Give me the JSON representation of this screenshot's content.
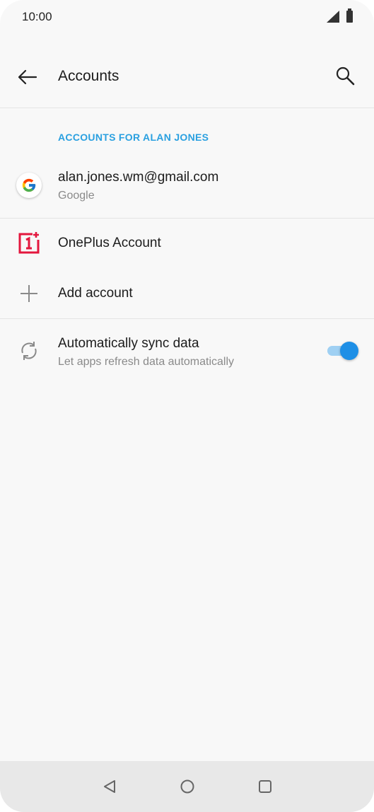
{
  "status_bar": {
    "time": "10:00"
  },
  "app_bar": {
    "title": "Accounts"
  },
  "section": {
    "header": "ACCOUNTS FOR ALAN JONES"
  },
  "accounts": [
    {
      "primary": "alan.jones.wm@gmail.com",
      "secondary": "Google",
      "icon": "google-icon"
    },
    {
      "primary": "OnePlus Account",
      "icon": "oneplus-icon"
    }
  ],
  "add_account": {
    "label": "Add account",
    "icon": "plus-icon"
  },
  "sync": {
    "label": "Automatically sync data",
    "description": "Let apps refresh data automatically",
    "enabled": true,
    "icon": "sync-icon"
  },
  "colors": {
    "accent": "#2aa0e0",
    "toggle_thumb": "#1e8fe6",
    "toggle_track": "#9fd0f3",
    "oneplus_red": "#e3173e"
  },
  "navigation": [
    "back-nav-icon",
    "home-nav-icon",
    "recents-nav-icon"
  ]
}
